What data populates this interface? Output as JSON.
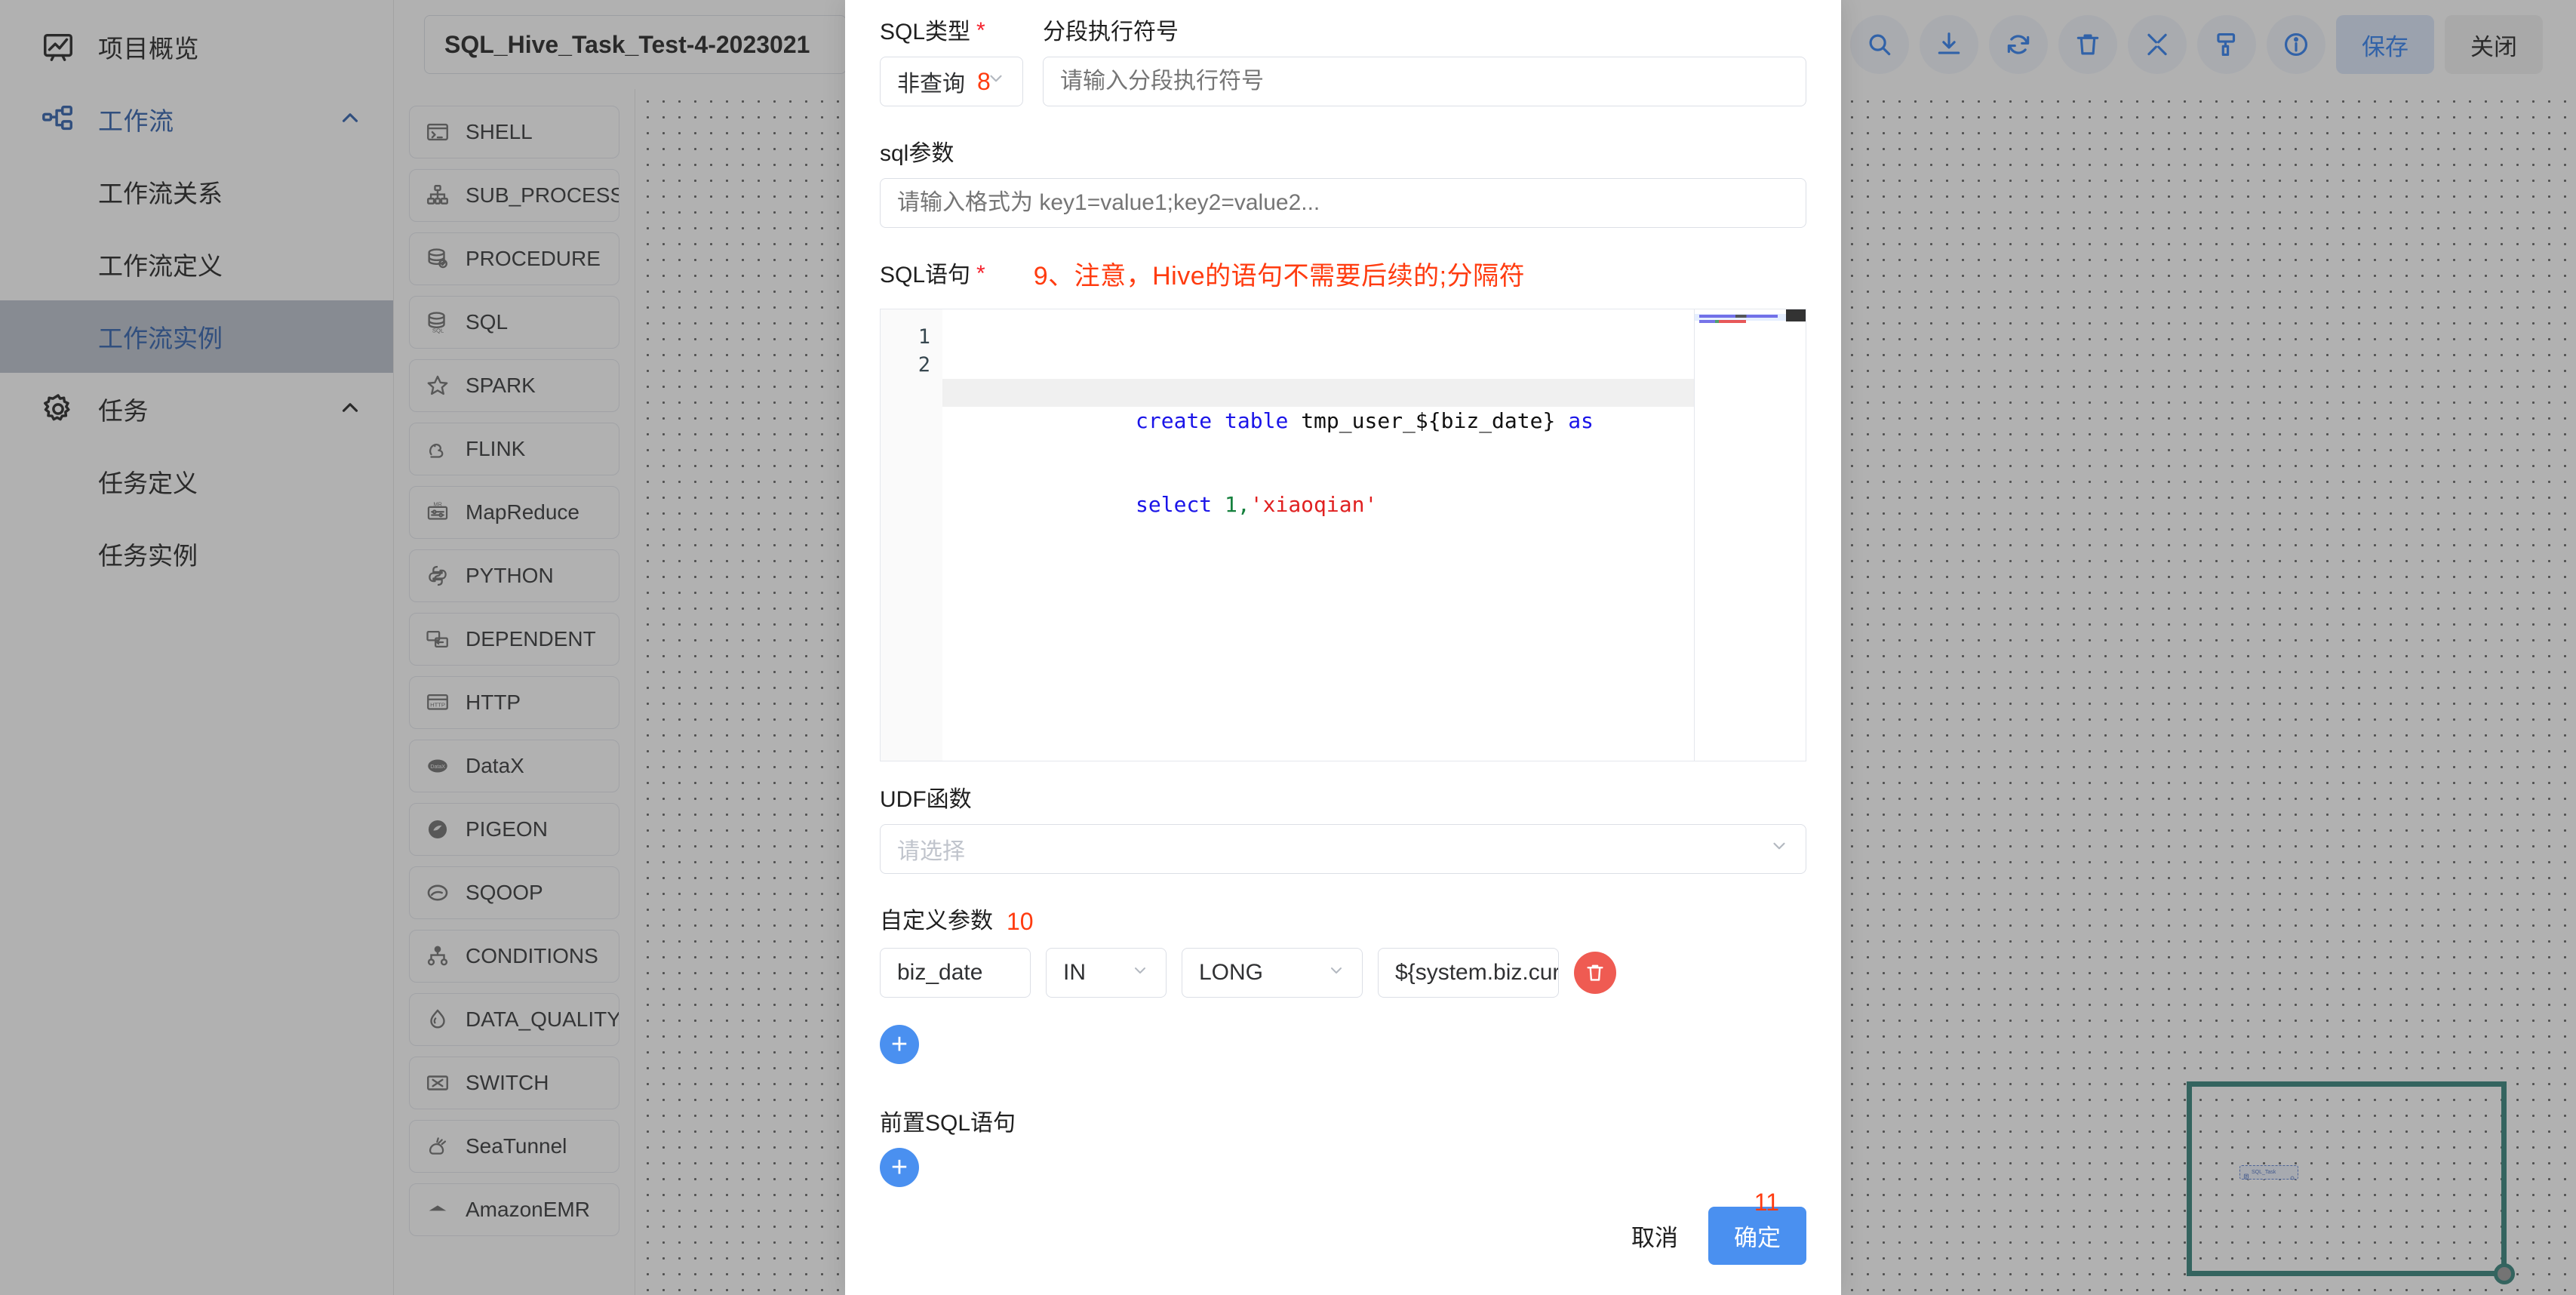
{
  "sidebar": {
    "items": [
      {
        "label": "项目概览",
        "icon": "overview-icon",
        "type": "parent",
        "active": false,
        "expandable": false
      },
      {
        "label": "工作流",
        "icon": "workflow-icon",
        "type": "parent",
        "active": true,
        "expandable": true
      },
      {
        "label": "工作流关系",
        "type": "child",
        "selected": false
      },
      {
        "label": "工作流定义",
        "type": "child",
        "selected": false
      },
      {
        "label": "工作流实例",
        "type": "child",
        "selected": true
      },
      {
        "label": "任务",
        "icon": "gear-icon",
        "type": "parent",
        "active": false,
        "expandable": true
      },
      {
        "label": "任务定义",
        "type": "child",
        "selected": false
      },
      {
        "label": "任务实例",
        "type": "child",
        "selected": false
      }
    ]
  },
  "topbar": {
    "workflow_title": "SQL_Hive_Task_Test-4-2023021",
    "tools": [
      {
        "name": "search-icon",
        "label": ""
      },
      {
        "name": "download-icon",
        "label": ""
      },
      {
        "name": "refresh-icon",
        "label": ""
      },
      {
        "name": "delete-icon",
        "label": ""
      },
      {
        "name": "fullscreen-icon",
        "label": ""
      },
      {
        "name": "format-icon",
        "label": ""
      },
      {
        "name": "info-icon",
        "label": ""
      }
    ],
    "save_label": "保存",
    "close_label": "关闭"
  },
  "task_panel": {
    "items": [
      {
        "label": "SHELL",
        "icon": "terminal-icon"
      },
      {
        "label": "SUB_PROCESS",
        "icon": "subprocess-icon"
      },
      {
        "label": "PROCEDURE",
        "icon": "database-check-icon"
      },
      {
        "label": "SQL",
        "icon": "database-sql-icon"
      },
      {
        "label": "SPARK",
        "icon": "star-icon"
      },
      {
        "label": "FLINK",
        "icon": "squirrel-icon"
      },
      {
        "label": "MapReduce",
        "icon": "mapreduce-icon"
      },
      {
        "label": "PYTHON",
        "icon": "python-icon"
      },
      {
        "label": "DEPENDENT",
        "icon": "dependent-icon"
      },
      {
        "label": "HTTP",
        "icon": "http-icon"
      },
      {
        "label": "DataX",
        "icon": "datax-icon"
      },
      {
        "label": "PIGEON",
        "icon": "pigeon-icon"
      },
      {
        "label": "SQOOP",
        "icon": "sqoop-icon"
      },
      {
        "label": "CONDITIONS",
        "icon": "conditions-icon"
      },
      {
        "label": "DATA_QUALITY",
        "icon": "dataquality-icon"
      },
      {
        "label": "SWITCH",
        "icon": "switch-icon"
      },
      {
        "label": "SeaTunnel",
        "icon": "seatunnel-icon"
      },
      {
        "label": "AmazonEMR",
        "icon": "emr-icon"
      }
    ]
  },
  "minimap": {
    "node_label": "SQL_Task"
  },
  "modal": {
    "sql_type": {
      "label": "SQL类型",
      "required_mark": "*",
      "value": "非查询",
      "annotation": "8"
    },
    "segment_symbol": {
      "label": "分段执行符号",
      "value": "",
      "placeholder": "请输入分段执行符号"
    },
    "sql_params": {
      "label": "sql参数",
      "value": "",
      "placeholder": "请输入格式为 key1=value1;key2=value2..."
    },
    "sql_statement": {
      "label": "SQL语句",
      "required_mark": "*",
      "annotation": "9、注意，Hive的语句不需要后续的;分隔符",
      "lines": [
        {
          "no": "1",
          "tokens": [
            {
              "t": "create ",
              "c": "kw"
            },
            {
              "t": "table ",
              "c": "kw"
            },
            {
              "t": "tmp_user_${biz_date} ",
              "c": "pl"
            },
            {
              "t": "as",
              "c": "kw"
            }
          ]
        },
        {
          "no": "2",
          "tokens": [
            {
              "t": "select ",
              "c": "kw"
            },
            {
              "t": "1",
              "c": "num"
            },
            {
              "t": ",",
              "c": "op"
            },
            {
              "t": "'xiaoqian'",
              "c": "str"
            }
          ]
        }
      ]
    },
    "udf": {
      "label": "UDF函数",
      "value": "",
      "placeholder": "请选择"
    },
    "custom_params": {
      "label": "自定义参数",
      "annotation": "10",
      "rows": [
        {
          "prop": "biz_date",
          "direction": "IN",
          "type": "LONG",
          "value": "${system.biz.cur"
        }
      ],
      "add_label": "+",
      "delete_icon": "trash-icon"
    },
    "pre_sql": {
      "label": "前置SQL语句",
      "add_label": "+"
    },
    "footer": {
      "cancel_label": "取消",
      "confirm_label": "确定",
      "annotation": "11"
    }
  },
  "colors": {
    "primary": "#4a90f0",
    "accent_blue": "#2a5caa",
    "annotation_red": "#ff3b0f",
    "danger": "#ef5b52",
    "minimap_border": "#2f7f77"
  }
}
